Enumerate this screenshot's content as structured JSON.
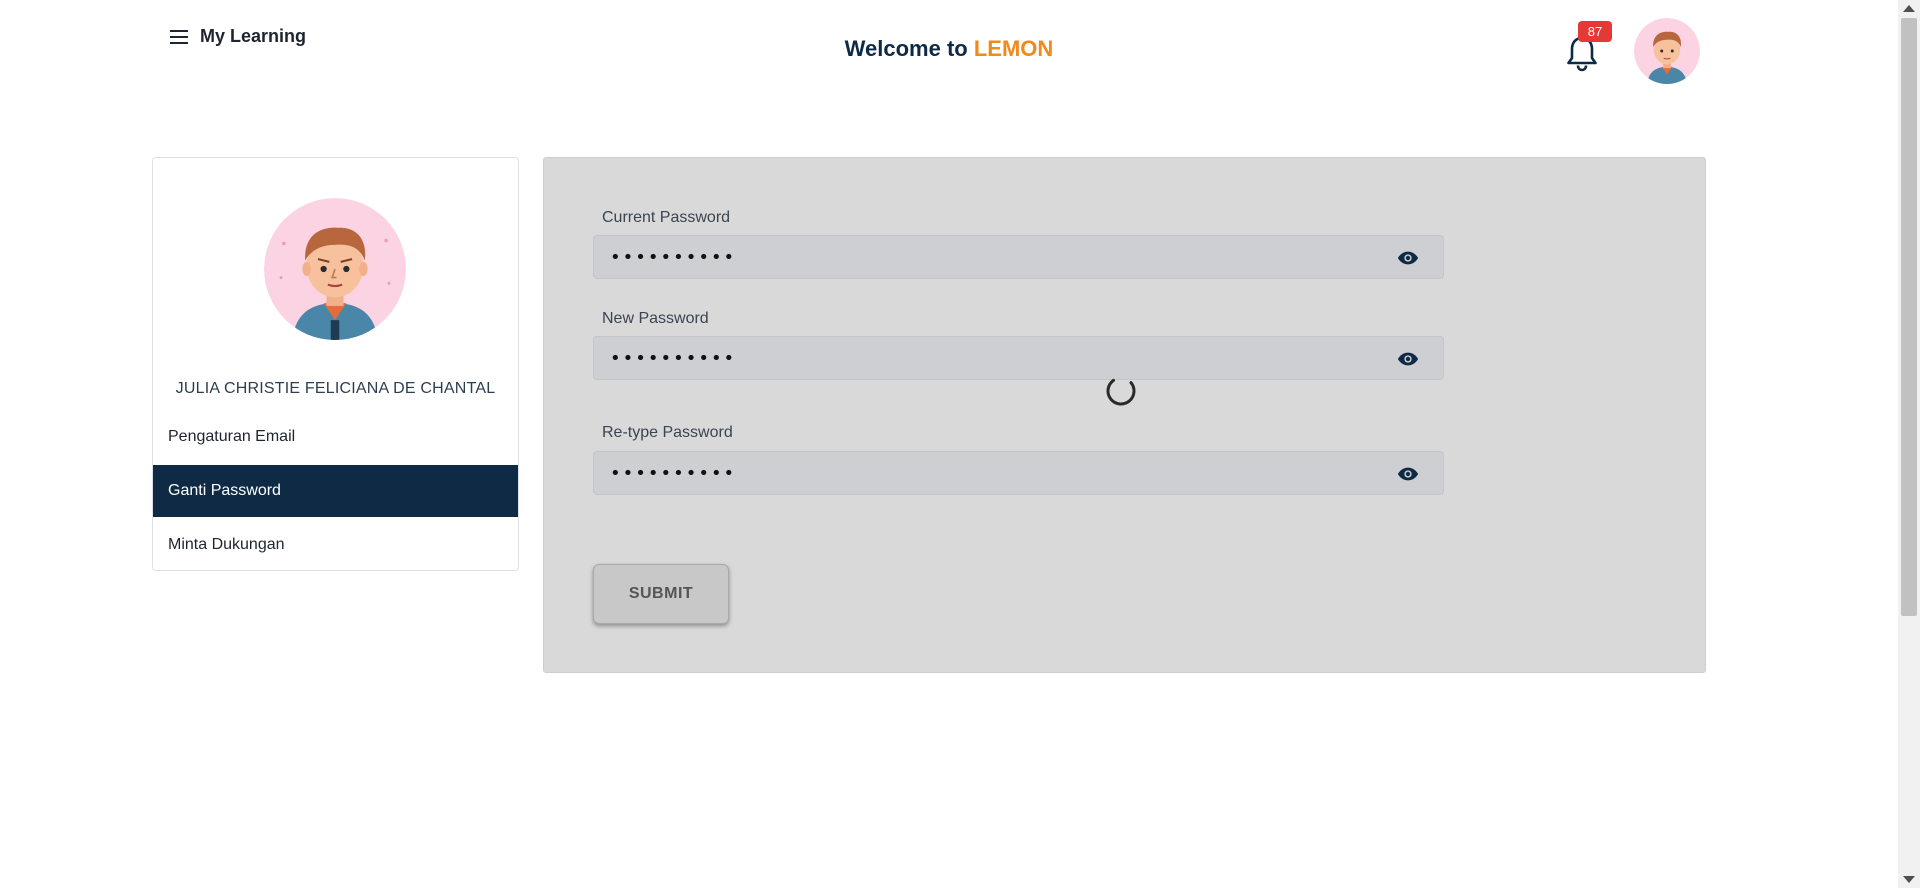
{
  "header": {
    "menu_label": "My Learning",
    "welcome_prefix": "Welcome to ",
    "brand": "LEMON",
    "notification_count": "87",
    "brand_color": "#f08a1c",
    "primary_color": "#0f2a45",
    "icons": {
      "menu": "hamburger-icon",
      "notifications": "bell-icon"
    }
  },
  "sidebar": {
    "user_name": "JULIA CHRISTIE FELICIANA DE CHANTAL",
    "items": [
      {
        "label": "Pengaturan Email",
        "active": false
      },
      {
        "label": "Ganti Password",
        "active": true
      },
      {
        "label": "Minta Dukungan",
        "active": false
      }
    ]
  },
  "form": {
    "fields": [
      {
        "label": "Current Password",
        "value": "••••••••••"
      },
      {
        "label": "New Password",
        "value": "••••••••••"
      },
      {
        "label": "Re-type Password",
        "value": "••••••••••"
      }
    ],
    "submit_label": "SUBMIT",
    "loading": true
  }
}
